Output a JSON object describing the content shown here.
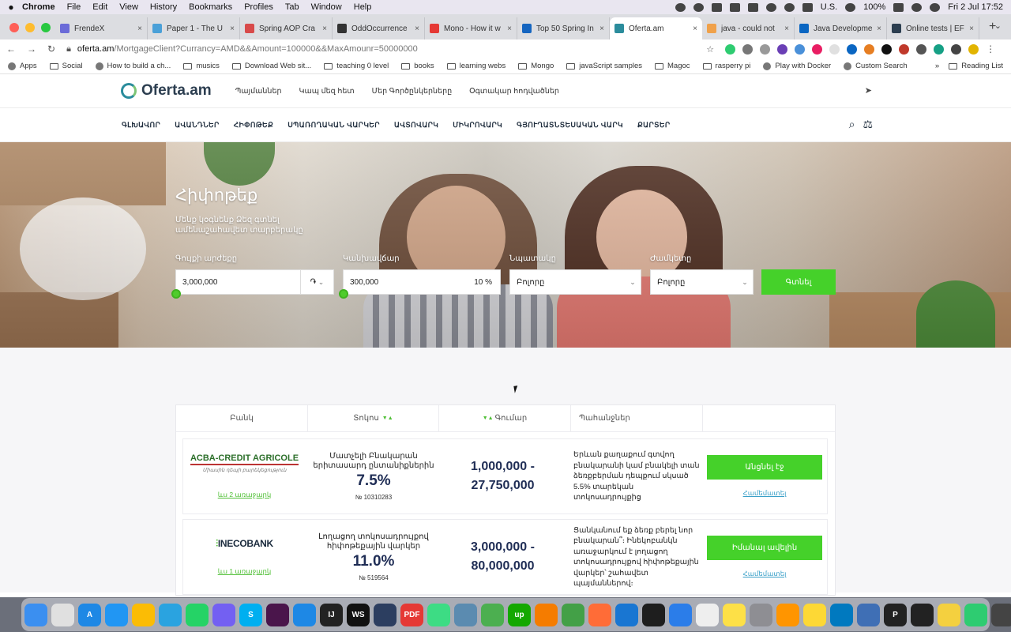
{
  "menubar": {
    "app": "Chrome",
    "items": [
      "File",
      "Edit",
      "View",
      "History",
      "Bookmarks",
      "Profiles",
      "Tab",
      "Window",
      "Help"
    ],
    "input_source": "U.S.",
    "battery": "100%",
    "clock": "Fri 2 Jul  17:52"
  },
  "tabs": [
    {
      "label": "FrendeX",
      "color": "#6b6bd8"
    },
    {
      "label": "Paper 1 - The U",
      "color": "#4aa0d8"
    },
    {
      "label": "Spring AOP Cra",
      "color": "#d84a4a"
    },
    {
      "label": "OddOccurrence",
      "color": "#333333"
    },
    {
      "label": "Mono - How it w",
      "color": "#e53935"
    },
    {
      "label": "Top 50 Spring In",
      "color": "#1565c0"
    },
    {
      "label": "Oferta.am",
      "color": "#2b8c9c"
    },
    {
      "label": "java - could not",
      "color": "#f0a14a"
    },
    {
      "label": "Java Developme",
      "color": "#0a66c2"
    },
    {
      "label": "Online tests | EF",
      "color": "#2c3e50"
    }
  ],
  "active_tab_index": 6,
  "address": {
    "host": "oferta.am",
    "path": "/MortgageClient?Currancy=AMD&&Amount=100000&&MaxAmounr=50000000"
  },
  "bookmarks": {
    "items": [
      {
        "label": "Apps",
        "icon": "apps-icon"
      },
      {
        "label": "Social",
        "icon": "folder-icon"
      },
      {
        "label": "How to build a ch...",
        "icon": "link-icon"
      },
      {
        "label": "musics",
        "icon": "folder-icon"
      },
      {
        "label": "Download Web sit...",
        "icon": "folder-icon"
      },
      {
        "label": "teaching 0 level",
        "icon": "folder-icon"
      },
      {
        "label": "books",
        "icon": "folder-icon"
      },
      {
        "label": "learning webs",
        "icon": "folder-icon"
      },
      {
        "label": "Mongo",
        "icon": "folder-icon"
      },
      {
        "label": "javaScript samples",
        "icon": "folder-icon"
      },
      {
        "label": "Magoc",
        "icon": "folder-icon"
      },
      {
        "label": "rasperry pi",
        "icon": "folder-icon"
      },
      {
        "label": "Play with Docker",
        "icon": "globe-icon"
      },
      {
        "label": "Custom Search",
        "icon": "google-icon"
      }
    ],
    "overflow": "»",
    "reading_list": "Reading List"
  },
  "site": {
    "logo": "Oferta.am",
    "top_links": [
      "Պայմաններ",
      "Կապ մեզ հետ",
      "Մեր Գործընկերները",
      "Օգտակար հոդվածներ"
    ],
    "nav": [
      "ԳԼԽԱՎՈՐ",
      "ԱՎԱՆԴՆԵՐ",
      "ՀԻՓՈԹԵՔ",
      "ՍՊԱՌՈՂԱԿԱՆ ՎԱՐԿԵՐ",
      "ԱՎՏՈՎԱՐԿ",
      "ՄԻԿՐՈՎԱՐԿ",
      "ԳՅՈՒՂԱՏՆՏԵՍԱԿԱՆ ՎԱՐԿ",
      "ՔԱՐՏԵՐ"
    ]
  },
  "hero": {
    "title": "Հիփոթեք",
    "subtitle": "Մենք կօգնենք Ձեզ գտնել ամենաշահավետ տարբերակը",
    "fields": [
      {
        "label": "Գույքի արժեքը",
        "value": "3,000,000",
        "suffix": "֏"
      },
      {
        "label": "Կանխավճար",
        "value": "300,000",
        "suffix": "10 %"
      },
      {
        "label": "Նպատակը",
        "value": "Բոլորը"
      },
      {
        "label": "Ժամկետը",
        "value": "Բոլորը"
      }
    ],
    "search_label": "Գտնել"
  },
  "table": {
    "headers": [
      "Բանկ",
      "Տոկոս",
      "Գումար",
      "Պահանջներ"
    ],
    "rows": [
      {
        "bank": "ACBA-CREDIT AGRICOLE",
        "bank_tagline": "Միասին դեպի բարեկեցություն",
        "more": "ևս 2 առաջարկ",
        "rate_desc": "Մատչելի Բնակարան երիտասարդ ընտանիքներին",
        "rate": "7.5%",
        "id": "№ 10310283",
        "amount_min": "1,000,000 -",
        "amount_max": "27,750,000",
        "requirements": "Երևան քաղաքում գտվող բնակարանի կամ բնակելի տան ձեռքբերման դեպքում սկսած 5.5% տարեկան տոկոսադրույքից",
        "button": "Անցնել էջ",
        "compare": "Համեմատել"
      },
      {
        "bank": "INECOBANK",
        "bank_tagline": "",
        "more": "ևս 1 առաջարկ",
        "rate_desc": "Լողացող տոկոսադրույքով հիփոթեքային վարկեր",
        "rate": "11.0%",
        "id": "№ 519564",
        "amount_min": "3,000,000 -",
        "amount_max": "80,000,000",
        "requirements": "Ցանկանում եք ձեռք բերել նոր բնակարան՞։ Ինեկոբանկն առաջարկում է լողացող տոկոսադրույքով հիփոթեքային վարկեր՝ շահավետ պայմաններով։",
        "button": "Իմանալ ավելին",
        "compare": "Համեմատել"
      }
    ]
  },
  "dock": [
    {
      "name": "finder",
      "color": "#3b8ff0",
      "glyph": ""
    },
    {
      "name": "launchpad",
      "color": "#e0e0e0",
      "glyph": ""
    },
    {
      "name": "app-store",
      "color": "#1e88e5",
      "glyph": "A"
    },
    {
      "name": "safari",
      "color": "#2196f3",
      "glyph": ""
    },
    {
      "name": "chrome",
      "color": "#fbbc05",
      "glyph": ""
    },
    {
      "name": "telegram",
      "color": "#2aa3e0",
      "glyph": ""
    },
    {
      "name": "whatsapp",
      "color": "#25d366",
      "glyph": ""
    },
    {
      "name": "viber",
      "color": "#7360f2",
      "glyph": ""
    },
    {
      "name": "skype",
      "color": "#00aff0",
      "glyph": "S"
    },
    {
      "name": "slack",
      "color": "#4a154b",
      "glyph": ""
    },
    {
      "name": "vscode",
      "color": "#1e88e5",
      "glyph": ""
    },
    {
      "name": "intellij",
      "color": "#222222",
      "glyph": "IJ"
    },
    {
      "name": "webstorm",
      "color": "#111111",
      "glyph": "WS"
    },
    {
      "name": "database",
      "color": "#2c3e60",
      "glyph": ""
    },
    {
      "name": "pdf",
      "color": "#e53935",
      "glyph": "PDF"
    },
    {
      "name": "android",
      "color": "#3ddc84",
      "glyph": ""
    },
    {
      "name": "mysql",
      "color": "#5b8bb0",
      "glyph": ""
    },
    {
      "name": "notes-green",
      "color": "#4caf50",
      "glyph": ""
    },
    {
      "name": "upwork",
      "color": "#14a800",
      "glyph": "up"
    },
    {
      "name": "rss",
      "color": "#f57c00",
      "glyph": ""
    },
    {
      "name": "maps",
      "color": "#43a047",
      "glyph": ""
    },
    {
      "name": "postman",
      "color": "#ff6c37",
      "glyph": ""
    },
    {
      "name": "xcode",
      "color": "#1976d2",
      "glyph": ""
    },
    {
      "name": "figma",
      "color": "#1e1e1e",
      "glyph": ""
    },
    {
      "name": "mail",
      "color": "#2b7de9",
      "glyph": ""
    },
    {
      "name": "textedit",
      "color": "#eeeeee",
      "glyph": ""
    },
    {
      "name": "notes",
      "color": "#fde047",
      "glyph": ""
    },
    {
      "name": "preferences",
      "color": "#8e8e93",
      "glyph": ""
    },
    {
      "name": "books",
      "color": "#ff9500",
      "glyph": ""
    },
    {
      "name": "stickies",
      "color": "#fdd835",
      "glyph": ""
    },
    {
      "name": "trello",
      "color": "#0079bf",
      "glyph": ""
    },
    {
      "name": "virtualbox",
      "color": "#3f6fb5",
      "glyph": ""
    },
    {
      "name": "proxy",
      "color": "#222222",
      "glyph": "P"
    },
    {
      "name": "terminal",
      "color": "#222222",
      "glyph": ""
    },
    {
      "name": "notes-yellow",
      "color": "#f4d03f",
      "glyph": ""
    },
    {
      "name": "keychain",
      "color": "#2ecc71",
      "glyph": ""
    },
    {
      "name": "calculator",
      "color": "#444444",
      "glyph": ""
    },
    {
      "name": "trash",
      "color": "#c8c8cc",
      "glyph": ""
    }
  ],
  "colors": {
    "accent_green": "#45d12a",
    "brand_navy": "#1f2d55",
    "brand_teal": "#2b8c9c",
    "link_blue": "#3aa0c8"
  }
}
